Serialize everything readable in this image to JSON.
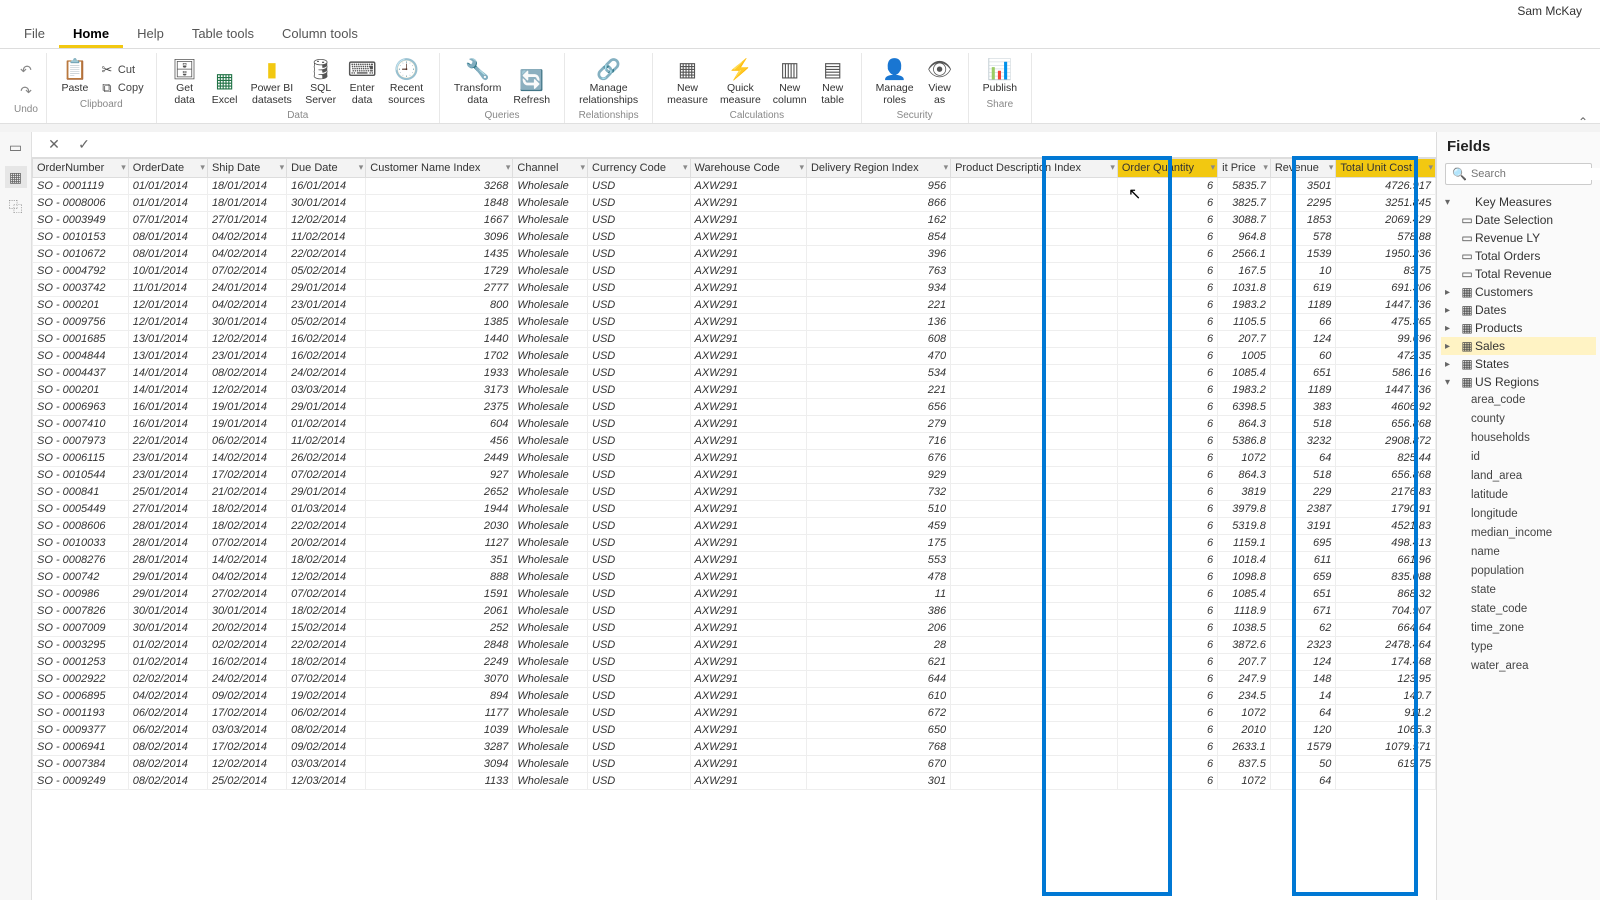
{
  "user": "Sam McKay",
  "tabs": [
    "File",
    "Home",
    "Help",
    "Table tools",
    "Column tools"
  ],
  "active_tab": 1,
  "ribbon": {
    "undo": "Undo",
    "clipboard": {
      "label": "Clipboard",
      "paste": "Paste",
      "cut": "Cut",
      "copy": "Copy"
    },
    "data": {
      "label": "Data",
      "get": "Get\ndata",
      "excel": "Excel",
      "pbi": "Power BI\ndatasets",
      "sql": "SQL\nServer",
      "enter": "Enter\ndata",
      "recent": "Recent\nsources"
    },
    "queries": {
      "label": "Queries",
      "transform": "Transform\ndata",
      "refresh": "Refresh"
    },
    "relationships": {
      "label": "Relationships",
      "manage": "Manage\nrelationships"
    },
    "calc": {
      "label": "Calculations",
      "measure": "New\nmeasure",
      "quick": "Quick\nmeasure",
      "column": "New\ncolumn",
      "table": "New\ntable"
    },
    "security": {
      "label": "Security",
      "roles": "Manage\nroles",
      "view": "View\nas"
    },
    "share": {
      "label": "Share",
      "publish": "Publish"
    }
  },
  "fields": {
    "title": "Fields",
    "search": "Search",
    "measures": {
      "label": "Key Measures",
      "items": [
        "Date Selection",
        "Revenue LY",
        "Total Orders",
        "Total Revenue"
      ]
    },
    "tables": [
      "Customers",
      "Dates",
      "Products",
      "Sales",
      "States",
      "US Regions"
    ],
    "selected": "Sales",
    "us_regions": [
      "area_code",
      "county",
      "households",
      "id",
      "land_area",
      "latitude",
      "longitude",
      "median_income",
      "name",
      "population",
      "state",
      "state_code",
      "time_zone",
      "type",
      "water_area"
    ]
  },
  "columns": [
    "OrderNumber",
    "OrderDate",
    "Ship Date",
    "Due Date",
    "Customer Name Index",
    "Channel",
    "Currency Code",
    "Warehouse Code",
    "Delivery Region Index",
    "Product Description Index",
    "Order Quantity",
    "it Price",
    "Revenue",
    "Total Unit Cost"
  ],
  "selected_columns": [
    10,
    13
  ],
  "rows": [
    [
      "SO - 0001119",
      "01/01/2014",
      "18/01/2014",
      "16/01/2014",
      "3268",
      "Wholesale",
      "USD",
      "AXW291",
      "956",
      "",
      "6",
      "5835.7",
      "3501",
      "4726.917"
    ],
    [
      "SO - 0008006",
      "01/01/2014",
      "18/01/2014",
      "30/01/2014",
      "1848",
      "Wholesale",
      "USD",
      "AXW291",
      "866",
      "",
      "6",
      "3825.7",
      "2295",
      "3251.845"
    ],
    [
      "SO - 0003949",
      "07/01/2014",
      "27/01/2014",
      "12/02/2014",
      "1667",
      "Wholesale",
      "USD",
      "AXW291",
      "162",
      "",
      "6",
      "3088.7",
      "1853",
      "2069.429"
    ],
    [
      "SO - 0010153",
      "08/01/2014",
      "04/02/2014",
      "11/02/2014",
      "3096",
      "Wholesale",
      "USD",
      "AXW291",
      "854",
      "",
      "6",
      "964.8",
      "578",
      "578.88"
    ],
    [
      "SO - 0010672",
      "08/01/2014",
      "04/02/2014",
      "22/02/2014",
      "1435",
      "Wholesale",
      "USD",
      "AXW291",
      "396",
      "",
      "6",
      "2566.1",
      "1539",
      "1950.236"
    ],
    [
      "SO - 0004792",
      "10/01/2014",
      "07/02/2014",
      "05/02/2014",
      "1729",
      "Wholesale",
      "USD",
      "AXW291",
      "763",
      "",
      "6",
      "167.5",
      "10",
      "83.75"
    ],
    [
      "SO - 0003742",
      "11/01/2014",
      "24/01/2014",
      "29/01/2014",
      "2777",
      "Wholesale",
      "USD",
      "AXW291",
      "934",
      "",
      "6",
      "1031.8",
      "619",
      "691.306"
    ],
    [
      "SO - 000201",
      "12/01/2014",
      "04/02/2014",
      "23/01/2014",
      "800",
      "Wholesale",
      "USD",
      "AXW291",
      "221",
      "",
      "6",
      "1983.2",
      "1189",
      "1447.736"
    ],
    [
      "SO - 0009756",
      "12/01/2014",
      "30/01/2014",
      "05/02/2014",
      "1385",
      "Wholesale",
      "USD",
      "AXW291",
      "136",
      "",
      "6",
      "1105.5",
      "66",
      "475.365"
    ],
    [
      "SO - 0001685",
      "13/01/2014",
      "12/02/2014",
      "16/02/2014",
      "1440",
      "Wholesale",
      "USD",
      "AXW291",
      "608",
      "",
      "6",
      "207.7",
      "124",
      "99.696"
    ],
    [
      "SO - 0004844",
      "13/01/2014",
      "23/01/2014",
      "16/02/2014",
      "1702",
      "Wholesale",
      "USD",
      "AXW291",
      "470",
      "",
      "6",
      "1005",
      "60",
      "472.35"
    ],
    [
      "SO - 0004437",
      "14/01/2014",
      "08/02/2014",
      "24/02/2014",
      "1933",
      "Wholesale",
      "USD",
      "AXW291",
      "534",
      "",
      "6",
      "1085.4",
      "651",
      "586.116"
    ],
    [
      "SO - 000201",
      "14/01/2014",
      "12/02/2014",
      "03/03/2014",
      "3173",
      "Wholesale",
      "USD",
      "AXW291",
      "221",
      "",
      "6",
      "1983.2",
      "1189",
      "1447.736"
    ],
    [
      "SO - 0006963",
      "16/01/2014",
      "19/01/2014",
      "29/01/2014",
      "2375",
      "Wholesale",
      "USD",
      "AXW291",
      "656",
      "",
      "6",
      "6398.5",
      "383",
      "4606.92"
    ],
    [
      "SO - 0007410",
      "16/01/2014",
      "19/01/2014",
      "01/02/2014",
      "604",
      "Wholesale",
      "USD",
      "AXW291",
      "279",
      "",
      "6",
      "864.3",
      "518",
      "656.868"
    ],
    [
      "SO - 0007973",
      "22/01/2014",
      "06/02/2014",
      "11/02/2014",
      "456",
      "Wholesale",
      "USD",
      "AXW291",
      "716",
      "",
      "6",
      "5386.8",
      "3232",
      "2908.872"
    ],
    [
      "SO - 0006115",
      "23/01/2014",
      "14/02/2014",
      "26/02/2014",
      "2449",
      "Wholesale",
      "USD",
      "AXW291",
      "676",
      "",
      "6",
      "1072",
      "64",
      "825.44"
    ],
    [
      "SO - 0010544",
      "23/01/2014",
      "17/02/2014",
      "07/02/2014",
      "927",
      "Wholesale",
      "USD",
      "AXW291",
      "929",
      "",
      "6",
      "864.3",
      "518",
      "656.868"
    ],
    [
      "SO - 000841",
      "25/01/2014",
      "21/02/2014",
      "29/01/2014",
      "2652",
      "Wholesale",
      "USD",
      "AXW291",
      "732",
      "",
      "6",
      "3819",
      "229",
      "2176.83"
    ],
    [
      "SO - 0005449",
      "27/01/2014",
      "18/02/2014",
      "01/03/2014",
      "1944",
      "Wholesale",
      "USD",
      "AXW291",
      "510",
      "",
      "6",
      "3979.8",
      "2387",
      "1790.91"
    ],
    [
      "SO - 0008606",
      "28/01/2014",
      "18/02/2014",
      "22/02/2014",
      "2030",
      "Wholesale",
      "USD",
      "AXW291",
      "459",
      "",
      "6",
      "5319.8",
      "3191",
      "4521.83"
    ],
    [
      "SO - 0010033",
      "28/01/2014",
      "07/02/2014",
      "20/02/2014",
      "1127",
      "Wholesale",
      "USD",
      "AXW291",
      "175",
      "",
      "6",
      "1159.1",
      "695",
      "498.413"
    ],
    [
      "SO - 0008276",
      "28/01/2014",
      "14/02/2014",
      "18/02/2014",
      "351",
      "Wholesale",
      "USD",
      "AXW291",
      "553",
      "",
      "6",
      "1018.4",
      "611",
      "661.96"
    ],
    [
      "SO - 000742",
      "29/01/2014",
      "04/02/2014",
      "12/02/2014",
      "888",
      "Wholesale",
      "USD",
      "AXW291",
      "478",
      "",
      "6",
      "1098.8",
      "659",
      "835.088"
    ],
    [
      "SO - 000986",
      "29/01/2014",
      "27/02/2014",
      "07/02/2014",
      "1591",
      "Wholesale",
      "USD",
      "AXW291",
      "11",
      "",
      "6",
      "1085.4",
      "651",
      "868.32"
    ],
    [
      "SO - 0007826",
      "30/01/2014",
      "30/01/2014",
      "18/02/2014",
      "2061",
      "Wholesale",
      "USD",
      "AXW291",
      "386",
      "",
      "6",
      "1118.9",
      "671",
      "704.907"
    ],
    [
      "SO - 0007009",
      "30/01/2014",
      "20/02/2014",
      "15/02/2014",
      "252",
      "Wholesale",
      "USD",
      "AXW291",
      "206",
      "",
      "6",
      "1038.5",
      "62",
      "664.64"
    ],
    [
      "SO - 0003295",
      "01/02/2014",
      "02/02/2014",
      "22/02/2014",
      "2848",
      "Wholesale",
      "USD",
      "AXW291",
      "28",
      "",
      "6",
      "3872.6",
      "2323",
      "2478.464"
    ],
    [
      "SO - 0001253",
      "01/02/2014",
      "16/02/2014",
      "18/02/2014",
      "2249",
      "Wholesale",
      "USD",
      "AXW291",
      "621",
      "",
      "6",
      "207.7",
      "124",
      "174.468"
    ],
    [
      "SO - 0002922",
      "02/02/2014",
      "24/02/2014",
      "07/02/2014",
      "3070",
      "Wholesale",
      "USD",
      "AXW291",
      "644",
      "",
      "6",
      "247.9",
      "148",
      "123.95"
    ],
    [
      "SO - 0006895",
      "04/02/2014",
      "09/02/2014",
      "19/02/2014",
      "894",
      "Wholesale",
      "USD",
      "AXW291",
      "610",
      "",
      "6",
      "234.5",
      "14",
      "140.7"
    ],
    [
      "SO - 0001193",
      "06/02/2014",
      "17/02/2014",
      "06/02/2014",
      "1177",
      "Wholesale",
      "USD",
      "AXW291",
      "672",
      "",
      "6",
      "1072",
      "64",
      "911.2"
    ],
    [
      "SO - 0009377",
      "06/02/2014",
      "03/03/2014",
      "08/02/2014",
      "1039",
      "Wholesale",
      "USD",
      "AXW291",
      "650",
      "",
      "6",
      "2010",
      "120",
      "1065.3"
    ],
    [
      "SO - 0006941",
      "08/02/2014",
      "17/02/2014",
      "09/02/2014",
      "3287",
      "Wholesale",
      "USD",
      "AXW291",
      "768",
      "",
      "6",
      "2633.1",
      "1579",
      "1079.571"
    ],
    [
      "SO - 0007384",
      "08/02/2014",
      "12/02/2014",
      "03/03/2014",
      "3094",
      "Wholesale",
      "USD",
      "AXW291",
      "670",
      "",
      "6",
      "837.5",
      "50",
      "619.75"
    ],
    [
      "SO - 0009249",
      "08/02/2014",
      "25/02/2014",
      "12/03/2014",
      "1133",
      "Wholesale",
      "USD",
      "AXW291",
      "301",
      "",
      "6",
      "1072",
      "64",
      ""
    ]
  ]
}
